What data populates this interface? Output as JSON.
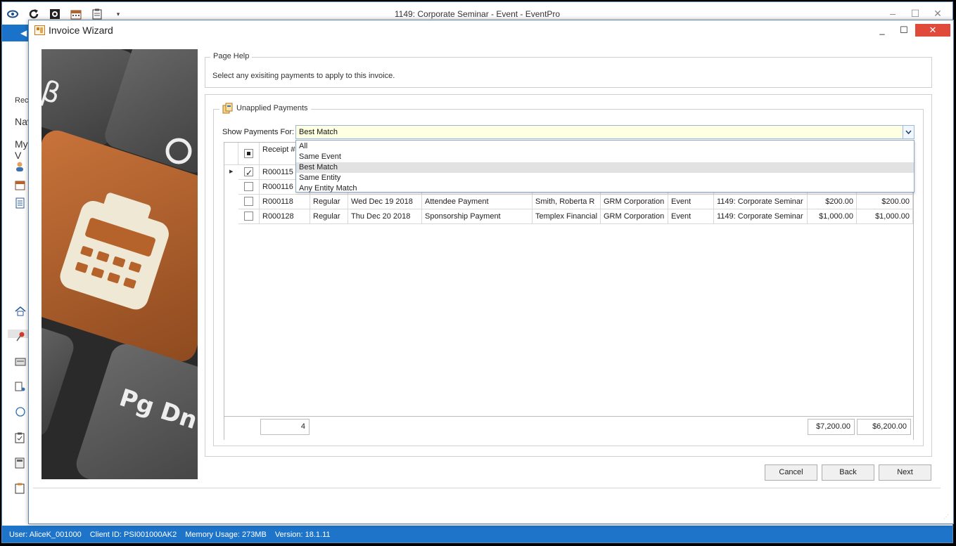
{
  "app": {
    "title": "1149: Corporate Seminar - Event - EventPro",
    "controls": {
      "minimize": "–",
      "maximize": "☐",
      "close": "✕"
    }
  },
  "bg_nav": {
    "rec": "Rec",
    "nav": "Nav",
    "my": "My V"
  },
  "dialog": {
    "title": "Invoice Wizard",
    "controls": {
      "minimize": "_",
      "maximize": "☐",
      "close": "✕"
    }
  },
  "page_help": {
    "legend": "Page Help",
    "text": "Select any exisiting payments to apply to this invoice."
  },
  "payments": {
    "legend": "Unapplied Payments",
    "show_label": "Show Payments For:",
    "show_value": "Best Match",
    "options": [
      "All",
      "Same Event",
      "Best Match",
      "Same Entity",
      "Any Entity Match"
    ],
    "selected_option": "Best Match"
  },
  "grid": {
    "header": {
      "receipt": "Receipt #"
    },
    "rows": [
      {
        "checked": true,
        "current": true,
        "receipt": "R000115",
        "type": "",
        "date": "",
        "description": "",
        "payer": "",
        "entity": "",
        "kind": "",
        "event": "",
        "amount": "",
        "balance": ""
      },
      {
        "checked": false,
        "current": false,
        "receipt": "R000116",
        "type": "",
        "date": "",
        "description": "",
        "payer": "",
        "entity": "",
        "kind": "",
        "event": "",
        "amount": "",
        "balance": ""
      },
      {
        "checked": false,
        "current": false,
        "receipt": "R000118",
        "type": "Regular",
        "date": "Wed Dec 19 2018",
        "description": "Attendee Payment",
        "payer": "Smith, Roberta R",
        "entity": "GRM Corporation",
        "kind": "Event",
        "event": "1149: Corporate Seminar",
        "amount": "$200.00",
        "balance": "$200.00"
      },
      {
        "checked": false,
        "current": false,
        "receipt": "R000128",
        "type": "Regular",
        "date": "Thu Dec 20 2018",
        "description": "Sponsorship Payment",
        "payer": "Templex Financial",
        "entity": "GRM Corporation",
        "kind": "Event",
        "event": "1149: Corporate Seminar",
        "amount": "$1,000.00",
        "balance": "$1,000.00"
      }
    ],
    "footer": {
      "count": "4",
      "amount_total": "$7,200.00",
      "balance_total": "$6,200.00"
    }
  },
  "buttons": {
    "cancel": "Cancel",
    "back": "Back",
    "next": "Next"
  },
  "status": {
    "user": "User: AliceK_001000",
    "client": "Client ID: PSI001000AK2",
    "memory": "Memory Usage: 273MB",
    "version": "Version: 18.1.11"
  },
  "colors": {
    "accent": "#1e74c8",
    "close": "#e04a3a",
    "combo_bg": "#ffffe1",
    "hero_key": "#b5622b"
  }
}
